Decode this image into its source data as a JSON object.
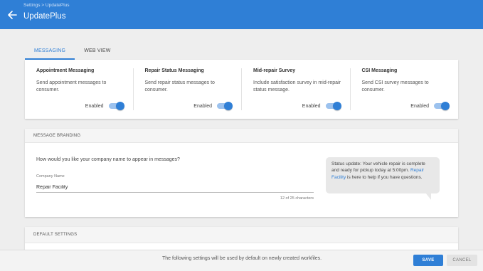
{
  "header": {
    "breadcrumb": "Settings > UpdatePlus",
    "title": "UpdatePlus",
    "back_icon": "arrow-left-icon"
  },
  "tabs": [
    {
      "label": "MESSAGING",
      "active": true
    },
    {
      "label": "WEB VIEW",
      "active": false
    }
  ],
  "features": [
    {
      "title": "Appointment Messaging",
      "description": "Send appointment messages to consumer.",
      "status": "Enabled",
      "enabled": true
    },
    {
      "title": "Repair Status Messaging",
      "description": "Send repair status messages to consumer.",
      "status": "Enabled",
      "enabled": true
    },
    {
      "title": "Mid-repair Survey",
      "description": "Include satisfaction survey in mid-repair status message.",
      "status": "Enabled",
      "enabled": true
    },
    {
      "title": "CSI Messaging",
      "description": "Send CSI survey messages to consumer.",
      "status": "Enabled",
      "enabled": true
    }
  ],
  "branding": {
    "section_title": "MESSAGE BRANDING",
    "question": "How would you like your company name to appear in messages?",
    "field_label": "Company Name",
    "field_value": "Repair Facility",
    "counter": "12 of 25 characters",
    "preview": {
      "before": "Status update: Your vehicle repair is complete and ready for pickup today at 5:00pm. ",
      "company": "Repair Facility",
      "after": " is here to help if you have questions."
    }
  },
  "defaults": {
    "section_title": "DEFAULT SETTINGS"
  },
  "footer": {
    "note": "The following settings will be used by default on newly created workfiles.",
    "save_label": "SAVE",
    "cancel_label": "CANCEL"
  },
  "colors": {
    "primary": "#2f7fd6",
    "background": "#eeeeee"
  }
}
